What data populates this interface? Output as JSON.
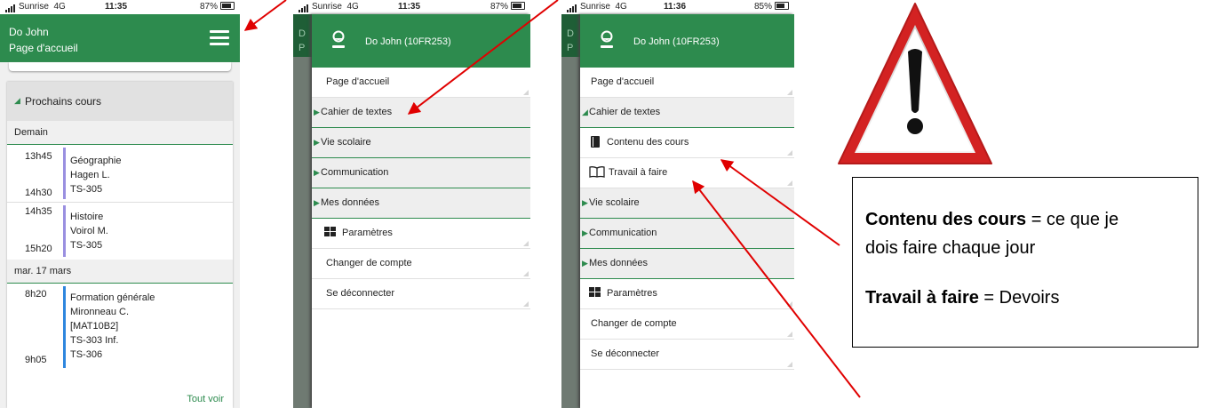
{
  "status1": {
    "carrier": "Sunrise",
    "network": "4G",
    "time": "11:35",
    "battery": "87%"
  },
  "status2": {
    "carrier": "Sunrise",
    "network": "4G",
    "time": "11:35",
    "battery": "87%"
  },
  "status3": {
    "carrier": "Sunrise",
    "network": "4G",
    "time": "11:36",
    "battery": "85%"
  },
  "phone1": {
    "header_name": "Do John",
    "header_page": "Page d'accueil",
    "section_title": "Prochains cours",
    "days": [
      {
        "label": "Demain",
        "courses": [
          {
            "start": "13h45",
            "end": "14h30",
            "lines": [
              "Géographie",
              "Hagen L.",
              "TS-305"
            ]
          },
          {
            "start": "14h35",
            "end": "15h20",
            "lines": [
              "Histoire",
              "Voirol M.",
              "TS-305"
            ]
          }
        ]
      },
      {
        "label": "mar. 17 mars",
        "courses": [
          {
            "start": "8h20",
            "end": "9h05",
            "lines": [
              "Formation générale",
              "Mironneau C.",
              "[MAT10B2]",
              "TS-303 Inf.",
              "TS-306"
            ]
          }
        ]
      }
    ],
    "see_all": "Tout voir"
  },
  "phone2": {
    "user": "Do John (10FR253)",
    "bg_letters": [
      "D",
      "P"
    ],
    "menu": [
      "Page d'accueil",
      "Cahier de textes",
      "Vie scolaire",
      "Communication",
      "Mes données",
      "Paramètres",
      "Changer de compte",
      "Se déconnecter"
    ]
  },
  "phone3": {
    "user": "Do John (10FR253)",
    "bg_letters": [
      "D",
      "P"
    ],
    "menu": [
      "Page d'accueil",
      "Cahier de textes",
      "Contenu des cours",
      "Travail à faire",
      "Vie scolaire",
      "Communication",
      "Mes données",
      "Paramètres",
      "Changer de compte",
      "Se déconnecter"
    ]
  },
  "note": {
    "line1_bold": "Contenu des cours",
    "line1_rest": " = ce que je",
    "line2": "dois faire chaque jour",
    "line3_bold": "Travail à faire",
    "line3_rest": " = Devoirs"
  },
  "colors": {
    "green": "#2d8b4e",
    "course_bar_1": "#9a8fe0",
    "course_bar_2": "#2e86de",
    "warning_red": "#d32222",
    "arrow_red": "#e00000"
  }
}
